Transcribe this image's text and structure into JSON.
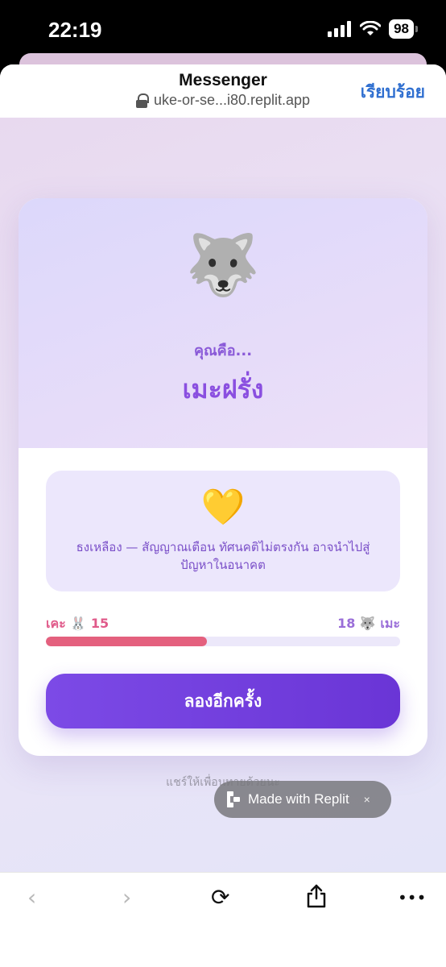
{
  "status_bar": {
    "time": "22:19",
    "battery": "98",
    "icons": [
      "signal-icon",
      "wifi-icon",
      "battery-icon"
    ]
  },
  "header": {
    "title": "Messenger",
    "url": "uke-or-se...i80.replit.app",
    "done_label": "เรียบร้อย"
  },
  "result": {
    "emoji": "🐺",
    "intro": "คุณคือ...",
    "name": "เมะฝรั่ง",
    "message_emoji": "💛",
    "message": "ธงเหลือง — สัญญาณเตือน ทัศนคติไม่ตรงกัน อาจนำไปสู่ปัญหาในอนาคต"
  },
  "score": {
    "left_label": "เคะ 🐰 15",
    "right_label": "18 🐺 เมะ",
    "left_value": 15,
    "right_value": 18,
    "fill_fraction": 0.455
  },
  "actions": {
    "retry_label": "ลองอีกครั้ง",
    "share_label": "แชร์ให้เพื่อนทายด้วยนะ"
  },
  "badge": {
    "label": "Made with Replit",
    "close": "×"
  },
  "toolbar": {
    "back": "‹",
    "forward": "›",
    "refresh": "⟳",
    "share": "⇧",
    "more": "•••"
  },
  "colors": {
    "accent": "#7c4ae6",
    "link": "#2f6fd0",
    "progress": "#e4607e"
  }
}
